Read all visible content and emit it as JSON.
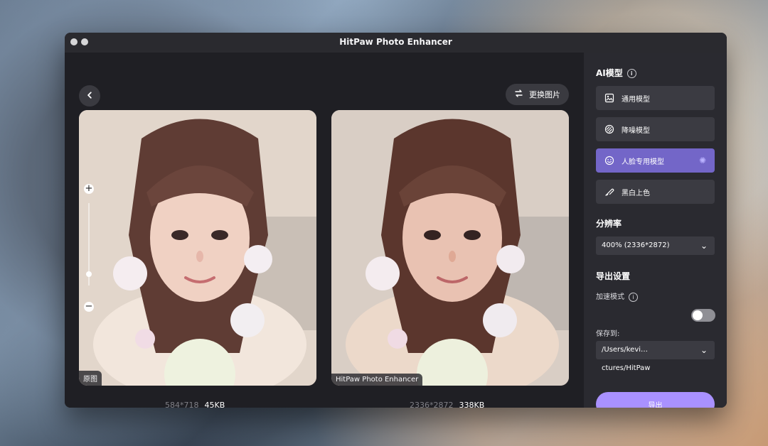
{
  "window": {
    "title": "HitPaw Photo Enhancer"
  },
  "toolbar": {
    "replace_image_label": "更换图片"
  },
  "panels": {
    "original_tag": "原图",
    "enhanced_tag": "HitPaw Photo Enhancer"
  },
  "stats": {
    "original_resolution": "584*718",
    "original_size": "45KB",
    "enhanced_resolution": "2336*2872",
    "enhanced_size": "338KB"
  },
  "sidebar": {
    "ai_model_title": "AI模型",
    "models": [
      {
        "label": "通用模型",
        "icon": "image-icon",
        "active": false
      },
      {
        "label": "降噪模型",
        "icon": "noise-icon",
        "active": false
      },
      {
        "label": "人脸专用模型",
        "icon": "face-icon",
        "active": true
      },
      {
        "label": "黑白上色",
        "icon": "brush-icon",
        "active": false
      }
    ],
    "resolution_title": "分辨率",
    "resolution_value": "400% (2336*2872)",
    "export_settings_title": "导出设置",
    "accelerate_label": "加速模式",
    "save_to_label": "保存到:",
    "save_path": "/Users/kevi…ctures/HitPaw",
    "export_label": "导出",
    "accent_color": "#7366c8",
    "export_color": "#a991ff"
  }
}
